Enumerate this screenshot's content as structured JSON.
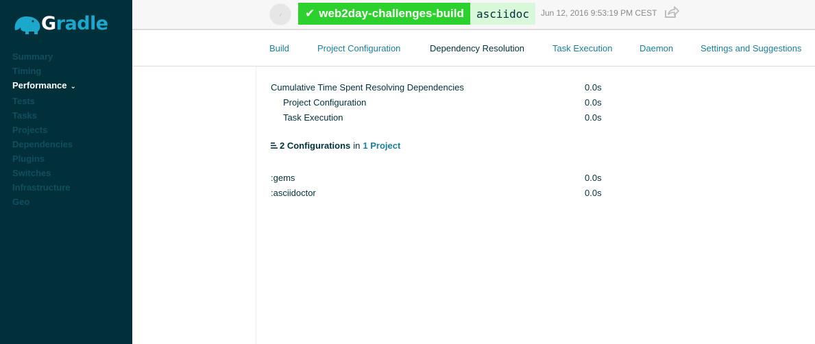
{
  "app": {
    "logo_text_main": "Gradle"
  },
  "sidebar": {
    "items": [
      {
        "label": "Summary",
        "active": false
      },
      {
        "label": "Timing",
        "active": false
      },
      {
        "label": "Performance",
        "active": true
      },
      {
        "label": "Tests",
        "active": false
      },
      {
        "label": "Tasks",
        "active": false
      },
      {
        "label": "Projects",
        "active": false
      },
      {
        "label": "Dependencies",
        "active": false
      },
      {
        "label": "Plugins",
        "active": false
      },
      {
        "label": "Switches",
        "active": false
      },
      {
        "label": "Infrastructure",
        "active": false
      },
      {
        "label": "Geo",
        "active": false
      }
    ]
  },
  "header": {
    "build_name": "web2day-challenges-build",
    "task": "asciidoc",
    "timestamp": "Jun 12, 2016 9:53:19 PM CEST",
    "status": "success",
    "status_color": "#2dd12d"
  },
  "tabs": [
    {
      "label": "Build",
      "active": false
    },
    {
      "label": "Project Configuration",
      "active": false
    },
    {
      "label": "Dependency Resolution",
      "active": true
    },
    {
      "label": "Task Execution",
      "active": false
    },
    {
      "label": "Daemon",
      "active": false
    },
    {
      "label": "Settings and Suggestions",
      "active": false
    }
  ],
  "summary": {
    "cumulative_label": "Cumulative Time Spent Resolving Dependencies",
    "cumulative_value": "0.0s",
    "project_config_label": "Project Configuration",
    "project_config_value": "0.0s",
    "task_exec_label": "Task Execution",
    "task_exec_value": "0.0s"
  },
  "configurations": {
    "count_label": "2 Configurations",
    "in_text": "in",
    "project_link": "1 Project",
    "rows": [
      {
        "name": ":gems",
        "time": "0.0s"
      },
      {
        "name": ":asciidoctor",
        "time": "0.0s"
      }
    ]
  },
  "colors": {
    "sidebar_bg": "#02303a",
    "link": "#1b7f99",
    "success": "#2dd12d"
  }
}
